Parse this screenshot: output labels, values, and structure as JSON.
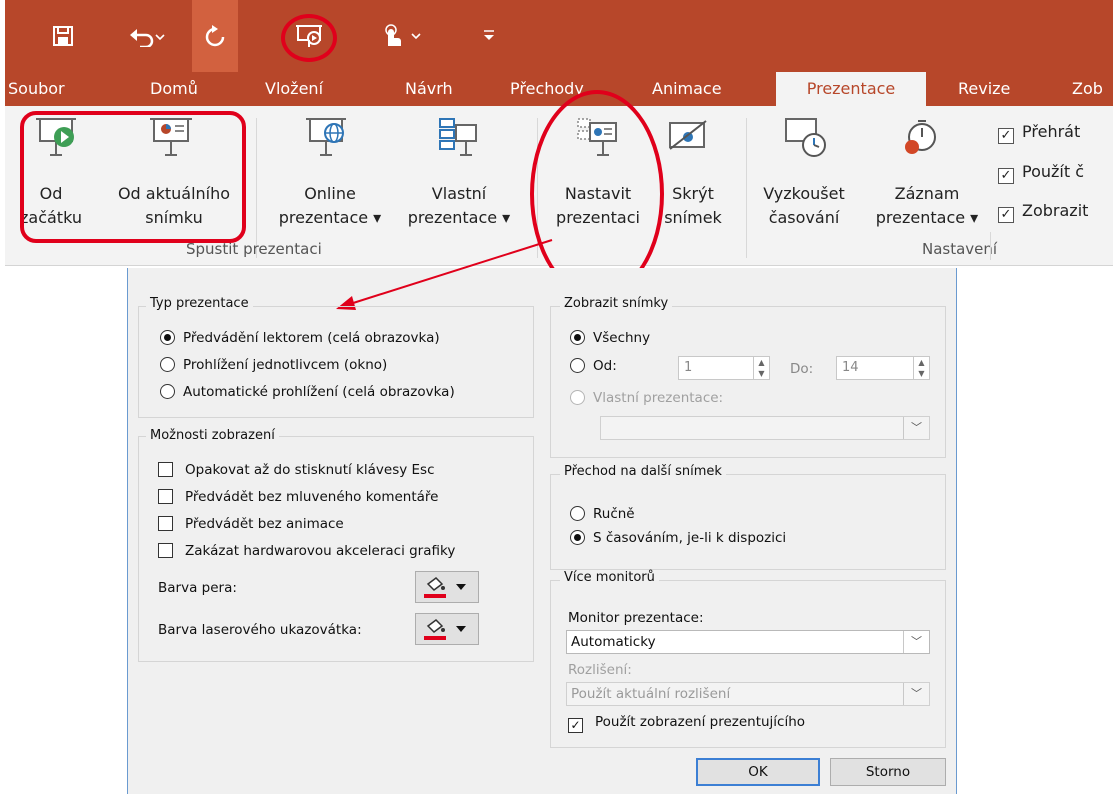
{
  "qat": {
    "save_icon": "save-icon",
    "undo_icon": "undo-icon",
    "repeat_icon": "repeat-icon",
    "present_icon": "start-presentation-icon",
    "touch_icon": "touch-mode-icon",
    "customize_icon": "customize-qat-icon"
  },
  "tabs": [
    "Soubor",
    "Domů",
    "Vložení",
    "Návrh",
    "Přechody",
    "Animace",
    "Prezentace",
    "Revize",
    "Zob"
  ],
  "ribbon": {
    "from_start": [
      "Od",
      "začátku"
    ],
    "from_current": [
      "Od aktuálního",
      "snímku"
    ],
    "online": [
      "Online",
      "prezentace ▾"
    ],
    "custom": [
      "Vlastní",
      "prezentace ▾"
    ],
    "setup": [
      "Nastavit",
      "prezentaci"
    ],
    "hide": [
      "Skrýt",
      "snímek"
    ],
    "rehearse": [
      "Vyzkoušet",
      "časování"
    ],
    "record": [
      "Záznam",
      "prezentace ▾"
    ],
    "check1": "Přehrát",
    "check2": "Použít č",
    "check3": "Zobrazit",
    "group1": "Spustit prezentaci",
    "group2": "Nastavení"
  },
  "dialog": {
    "type_legend": "Typ prezentace",
    "type_opt1": "Předvádění lektorem (celá obrazovka)",
    "type_opt2": "Prohlížení jednotlivcem (okno)",
    "type_opt3": "Automatické prohlížení (celá obrazovka)",
    "show_legend": "Možnosti zobrazení",
    "show_opt1": "Opakovat až do stisknutí klávesy Esc",
    "show_opt2": "Předvádět bez mluveného komentáře",
    "show_opt3": "Předvádět bez animace",
    "show_opt4": "Zakázat hardwarovou akceleraci grafiky",
    "pen_color": "Barva pera:",
    "laser_color": "Barva laserového ukazovátka:",
    "slides_legend": "Zobrazit snímky",
    "slides_all": "Všechny",
    "slides_from": "Od:",
    "from_value": "1",
    "to_label": "Do:",
    "to_value": "14",
    "custom_show": "Vlastní prezentace:",
    "advance_legend": "Přechod na další snímek",
    "advance_manual": "Ručně",
    "advance_timing": "S časováním, je-li k dispozici",
    "monitors_legend": "Více monitorů",
    "monitor_label": "Monitor prezentace:",
    "monitor_value": "Automaticky",
    "resolution_label": "Rozlišení:",
    "resolution_value": "Použít aktuální rozlišení",
    "presenter_view": "Použít zobrazení prezentujícího",
    "ok": "OK",
    "cancel": "Storno"
  },
  "colors": {
    "accent": "#b7472a",
    "annotation": "#e0001b",
    "pen_underline": "#e0001b"
  }
}
